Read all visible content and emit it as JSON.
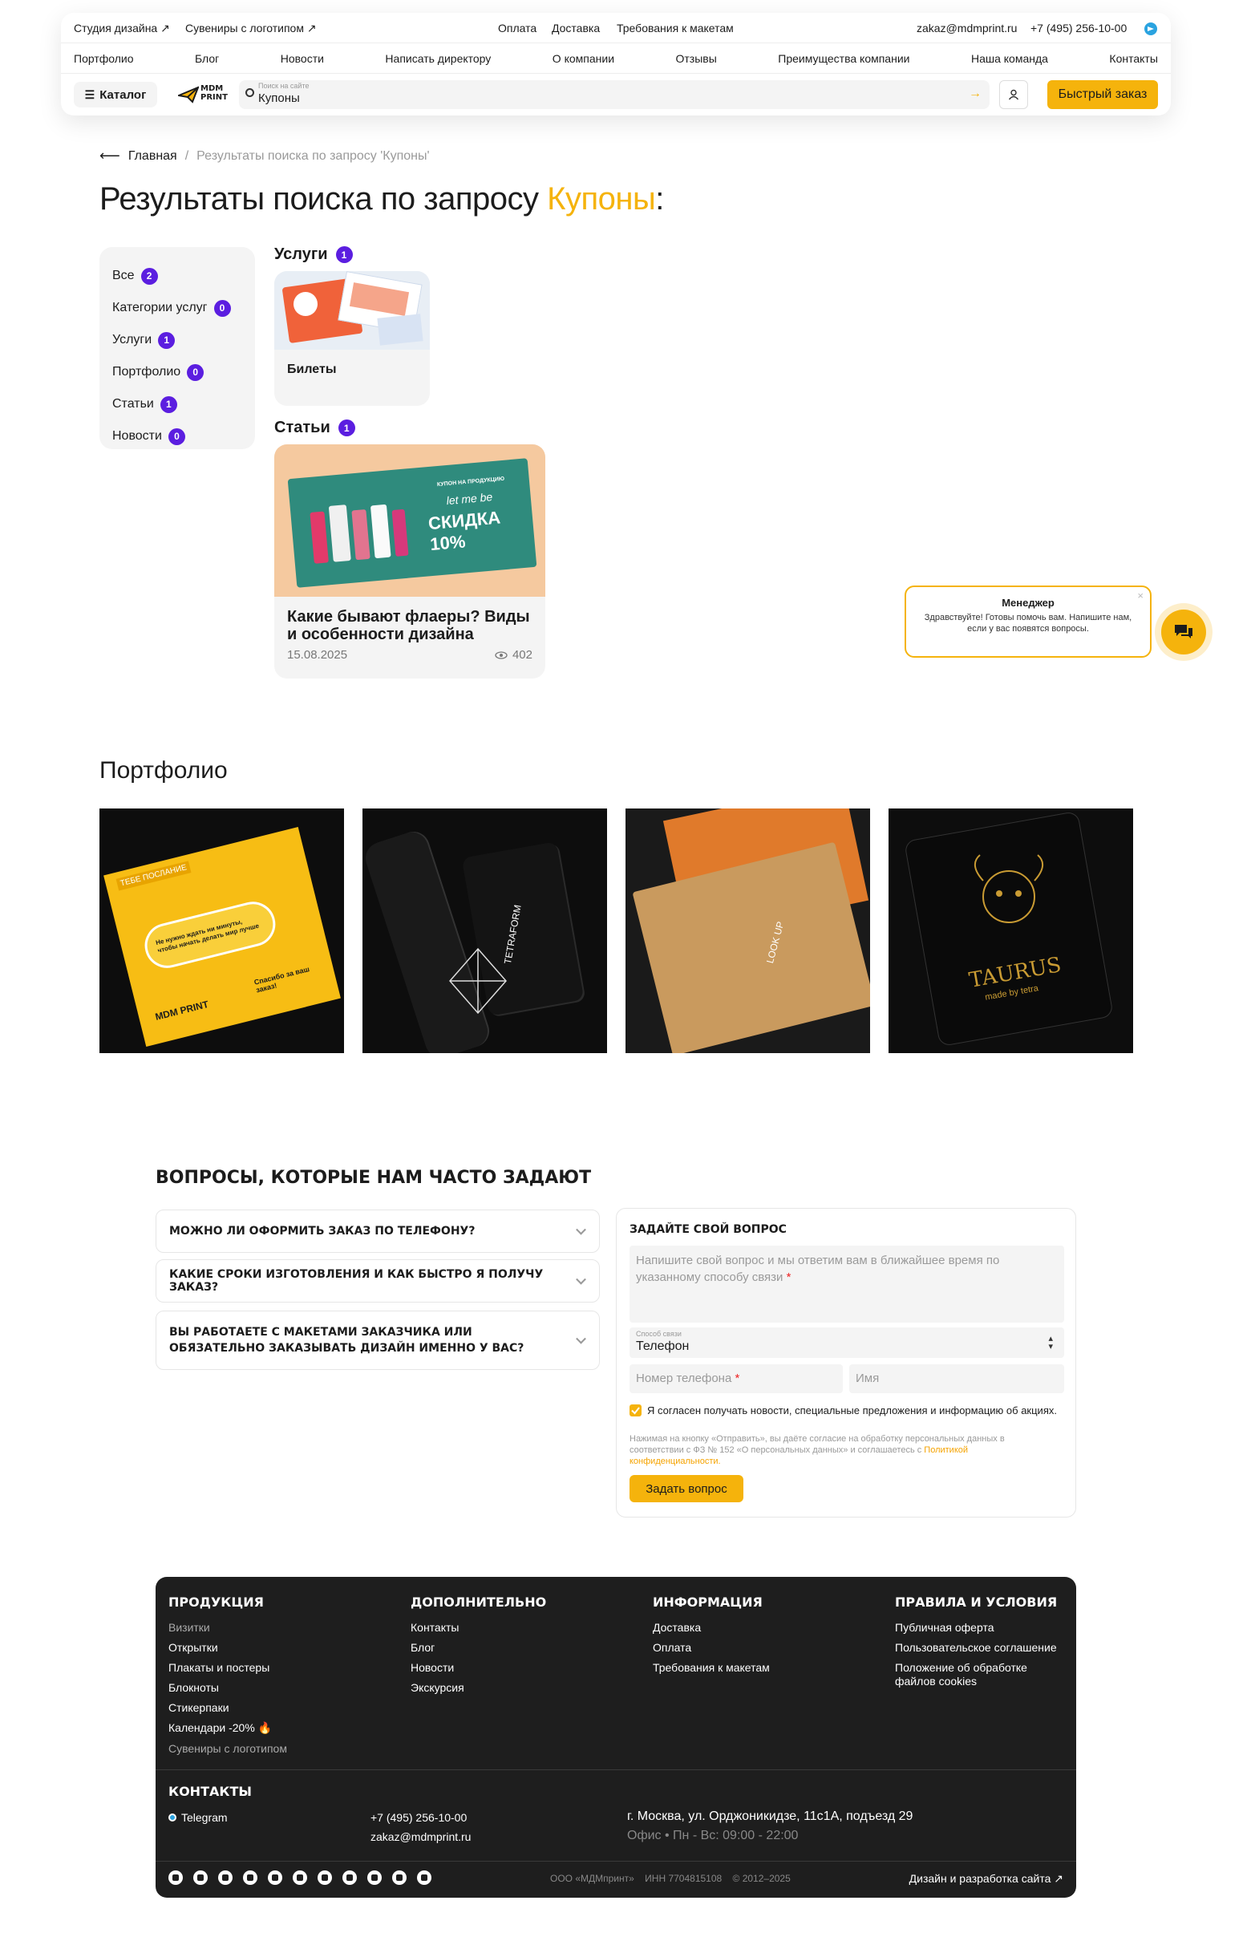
{
  "header": {
    "top_links": [
      "Студия дизайна ↗",
      "Сувениры с логотипом ↗"
    ],
    "center_links": [
      "Оплата",
      "Доставка",
      "Требования к макетам"
    ],
    "email": "zakaz@mdmprint.ru",
    "phone": "+7 (495) 256-10-00",
    "nav": [
      "Портфолио",
      "Блог",
      "Новости",
      "Написать директору",
      "О компании",
      "Отзывы",
      "Преимущества компании",
      "Наша команда",
      "Контакты"
    ],
    "catalog_label": "Каталог",
    "logo_line1": "MDM",
    "logo_line2": "PRINT",
    "search_hint": "Поиск на сайте",
    "search_value": "Купоны",
    "quick_order": "Быстрый заказ"
  },
  "breadcrumb": {
    "home": "Главная",
    "separator": "/",
    "current": "Результаты поиска по запросу 'Купоны'"
  },
  "page_title": {
    "prefix": "Результаты поиска по запросу ",
    "query": "Купоны",
    "suffix": ":"
  },
  "filters": [
    {
      "label": "Все",
      "count": "2"
    },
    {
      "label": "Категории услуг",
      "count": "0"
    },
    {
      "label": "Услуги",
      "count": "1"
    },
    {
      "label": "Портфолио",
      "count": "0"
    },
    {
      "label": "Статьи",
      "count": "1"
    },
    {
      "label": "Новости",
      "count": "0"
    }
  ],
  "services": {
    "heading": "Услуги",
    "count": "1",
    "card_title": "Билеты"
  },
  "articles": {
    "heading": "Статьи",
    "count": "1",
    "card_title": "Какие бывают флаеры? Виды и особенности дизайна",
    "date": "15.08.2025",
    "views": "402",
    "image_text": {
      "line1": "КУПОН НА ПРОДУКЦИЮ",
      "line2": "let me be",
      "line3": "СКИДКА 10%"
    }
  },
  "chat": {
    "title": "Менеджер",
    "text": "Здравствуйте! Готовы помочь вам. Напишите нам, если у вас появятся вопросы."
  },
  "portfolio": {
    "heading": "Портфолио",
    "item1": {
      "l1": "ТЕБЕ ПОСЛАНИЕ",
      "l2": "Не нужно ждать ни минуты, чтобы начать делать мир лучше",
      "l3": "Спасибо за ваш заказ!",
      "l4": "MDM PRINT"
    },
    "item2": {
      "l1": "TETRAFORM"
    },
    "item3": {
      "l1": "LOOK UP"
    },
    "item4": {
      "l1": "TAURUS",
      "l2": "made by tetra"
    }
  },
  "faq": {
    "heading": "ВОПРОСЫ, КОТОРЫЕ НАМ ЧАСТО ЗАДАЮТ",
    "questions": [
      "МОЖНО ЛИ ОФОРМИТЬ ЗАКАЗ ПО ТЕЛЕФОНУ?",
      "КАКИЕ СРОКИ ИЗГОТОВЛЕНИЯ И КАК БЫСТРО Я ПОЛУЧУ ЗАКАЗ?",
      "ВЫ РАБОТАЕТЕ С МАКЕТАМИ ЗАКАЗЧИКА ИЛИ ОБЯЗАТЕЛЬНО ЗАКАЗЫВАТЬ ДИЗАЙН ИМЕННО У ВАС?"
    ]
  },
  "ask_form": {
    "heading": "ЗАДАЙТЕ СВОЙ ВОПРОС",
    "question_placeholder": "Напишите свой вопрос и мы ответим вам в ближайшее время по указанному способу связи",
    "contact_label": "Способ связи",
    "contact_value": "Телефон",
    "phone_placeholder": "Номер телефона",
    "name_placeholder": "Имя",
    "consent": "Я согласен получать новости, специальные предложения и информацию об акциях.",
    "legal": "Нажимая на кнопку «Отправить», вы даёте согласие на обработку персональных данных в соответствии с ФЗ № 152 «О персональных данных» и соглашаетесь с",
    "legal_link": "Политикой конфиденциальности.",
    "submit": "Задать вопрос",
    "required_mark": "*"
  },
  "footer": {
    "products": {
      "title": "ПРОДУКЦИЯ",
      "items": [
        "Визитки",
        "Открытки",
        "Плакаты и постеры",
        "Блокноты",
        "Стикерпаки",
        "Календари -20% 🔥",
        "Сувениры с логотипом"
      ]
    },
    "extra": {
      "title": "ДОПОЛНИТЕЛЬНО",
      "items": [
        "Контакты",
        "Блог",
        "Новости",
        "Экскурсия"
      ]
    },
    "info": {
      "title": "ИНФОРМАЦИЯ",
      "items": [
        "Доставка",
        "Оплата",
        "Требования к макетам"
      ]
    },
    "rules": {
      "title": "ПРАВИЛА И УСЛОВИЯ",
      "items": [
        "Публичная оферта",
        "Пользовательское соглашение",
        "Положение об обработке файлов cookies"
      ]
    },
    "contacts_title": "КОНТАКТЫ",
    "telegram": "Telegram",
    "phone": "+7 (495) 256-10-00",
    "email": "zakaz@mdmprint.ru",
    "address": "г. Москва, ул. Орджоникидзе, 11с1А, подъезд 29",
    "hours": "Офис • Пн - Вс: 09:00 - 22:00",
    "company": "ООО «МДМпринт»",
    "inn": "ИНН 7704815108",
    "years": "© 2012–2025",
    "dev": "Дизайн и разработка сайта ↗"
  },
  "colors": {
    "accent": "#f5b30c",
    "badge": "#5b1ee0",
    "footer_bg": "#1e1e1e"
  }
}
